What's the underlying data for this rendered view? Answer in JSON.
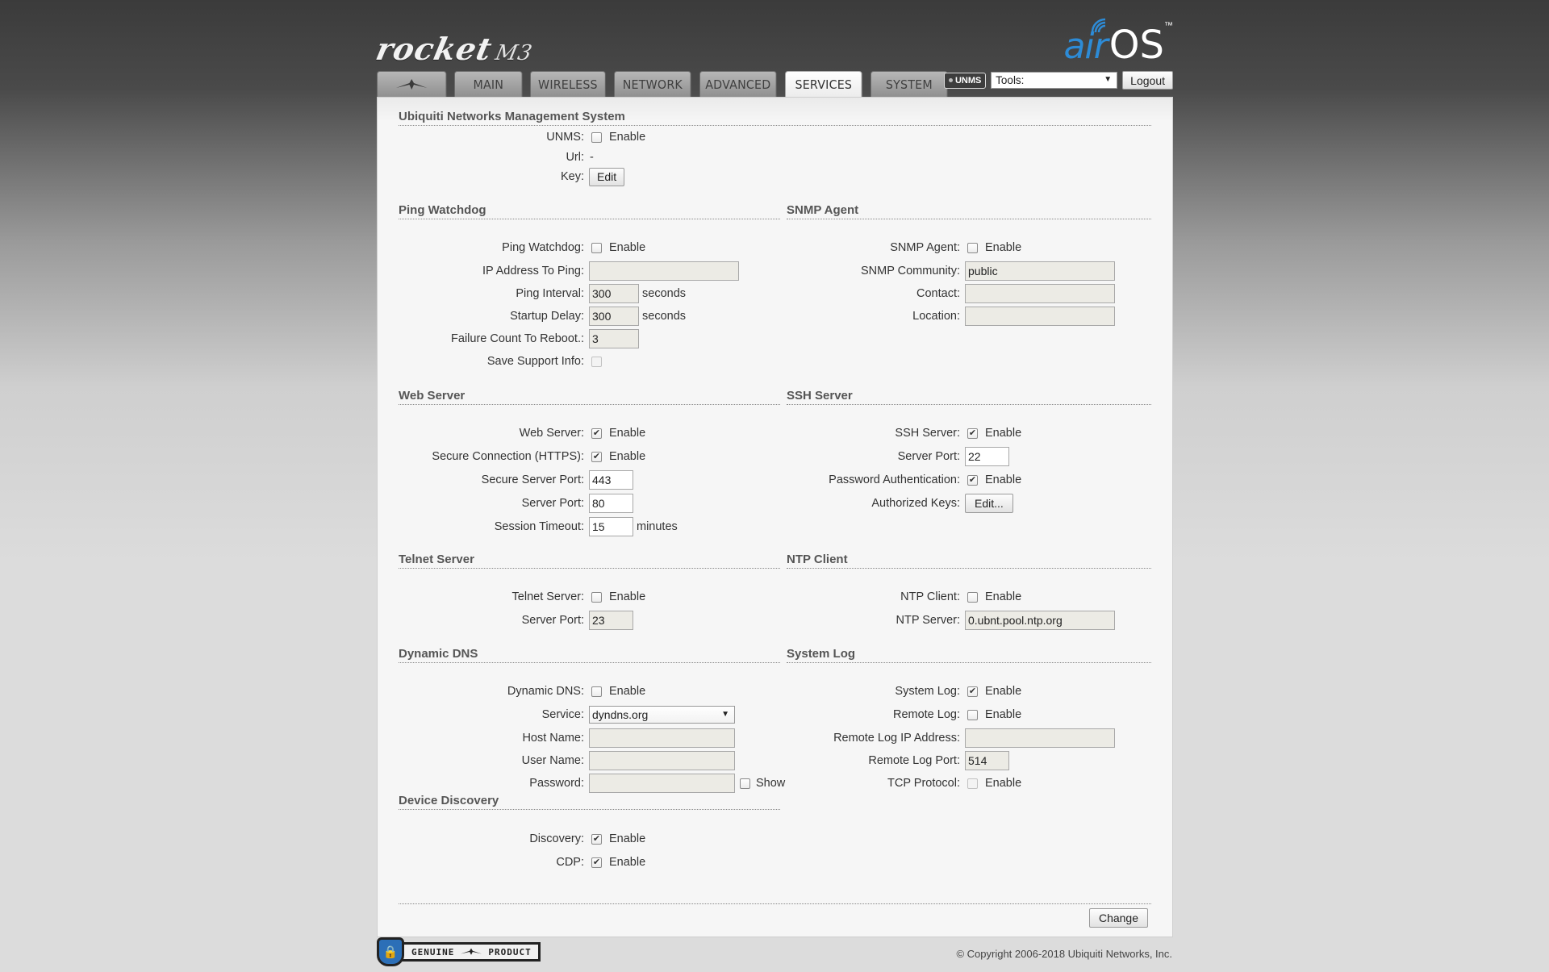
{
  "header": {
    "brand": "rocket",
    "model": "M3",
    "logo_air": "air",
    "logo_os": "OS",
    "logo_tm": "™"
  },
  "tabs": [
    {
      "label": "",
      "icon": "ubiquiti-logo-icon"
    },
    {
      "label": "MAIN"
    },
    {
      "label": "WIRELESS"
    },
    {
      "label": "NETWORK"
    },
    {
      "label": "ADVANCED"
    },
    {
      "label": "SERVICES",
      "active": true
    },
    {
      "label": "SYSTEM"
    }
  ],
  "tools": {
    "unms_badge": "UNMS",
    "select_value": "Tools:",
    "logout": "Logout"
  },
  "unms_section": {
    "title": "Ubiquiti Networks Management System",
    "unms_label": "UNMS:",
    "enable": "Enable",
    "url_label": "Url:",
    "url_value": "-",
    "key_label": "Key:",
    "edit": "Edit"
  },
  "ping_watchdog": {
    "title": "Ping Watchdog",
    "watchdog_label": "Ping Watchdog:",
    "enable": "Enable",
    "ip_label": "IP Address To Ping:",
    "ip_value": "",
    "interval_label": "Ping Interval:",
    "interval_value": "300",
    "seconds": "seconds",
    "delay_label": "Startup Delay:",
    "delay_value": "300",
    "failure_label": "Failure Count To Reboot.:",
    "failure_value": "3",
    "support_label": "Save Support Info:"
  },
  "snmp": {
    "title": "SNMP Agent",
    "agent_label": "SNMP Agent:",
    "enable": "Enable",
    "community_label": "SNMP Community:",
    "community_value": "public",
    "contact_label": "Contact:",
    "contact_value": "",
    "location_label": "Location:",
    "location_value": ""
  },
  "web_server": {
    "title": "Web Server",
    "server_label": "Web Server:",
    "enable": "Enable",
    "https_label": "Secure Connection (HTTPS):",
    "secure_port_label": "Secure Server Port:",
    "secure_port_value": "443",
    "port_label": "Server Port:",
    "port_value": "80",
    "timeout_label": "Session Timeout:",
    "timeout_value": "15",
    "minutes": "minutes"
  },
  "ssh": {
    "title": "SSH Server",
    "server_label": "SSH Server:",
    "enable": "Enable",
    "port_label": "Server Port:",
    "port_value": "22",
    "password_label": "Password Authentication:",
    "keys_label": "Authorized Keys:",
    "keys_button": "Edit..."
  },
  "telnet": {
    "title": "Telnet Server",
    "server_label": "Telnet Server:",
    "enable": "Enable",
    "port_label": "Server Port:",
    "port_value": "23"
  },
  "ntp": {
    "title": "NTP Client",
    "client_label": "NTP Client:",
    "enable": "Enable",
    "server_label": "NTP Server:",
    "server_value": "0.ubnt.pool.ntp.org"
  },
  "ddns": {
    "title": "Dynamic DNS",
    "ddns_label": "Dynamic DNS:",
    "enable": "Enable",
    "service_label": "Service:",
    "service_value": "dyndns.org",
    "host_label": "Host Name:",
    "host_value": "",
    "user_label": "User Name:",
    "user_value": "",
    "password_label": "Password:",
    "password_value": "",
    "show": "Show"
  },
  "syslog": {
    "title": "System Log",
    "log_label": "System Log:",
    "enable": "Enable",
    "remote_label": "Remote Log:",
    "remote_ip_label": "Remote Log IP Address:",
    "remote_ip_value": "",
    "remote_port_label": "Remote Log Port:",
    "remote_port_value": "514",
    "tcp_label": "TCP Protocol:"
  },
  "discovery": {
    "title": "Device Discovery",
    "discovery_label": "Discovery:",
    "enable": "Enable",
    "cdp_label": "CDP:"
  },
  "footer": {
    "change": "Change",
    "genuine": "GENUINE",
    "product": "PRODUCT",
    "copyright": "© Copyright 2006-2018 Ubiquiti Networks, Inc."
  },
  "checked_mark": "✔"
}
